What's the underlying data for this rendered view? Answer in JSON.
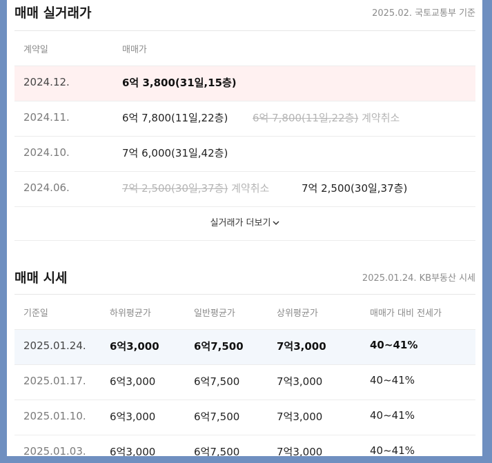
{
  "sale_trades": {
    "title": "매매 실거래가",
    "source_note": "2025.02. 국토교통부 기준",
    "columns": {
      "date": "계약일",
      "price": "매매가"
    },
    "rows": [
      {
        "date": "2024.12.",
        "price": "6억 3,800(31일,15층)"
      },
      {
        "date": "2024.11.",
        "price": "6억 7,800(11일,22층)",
        "cancelled_price": "6억 7,800(11일,22층)",
        "cancel_label": "계약취소"
      },
      {
        "date": "2024.10.",
        "price": "7억 6,000(31일,42층)"
      },
      {
        "date": "2024.06.",
        "cancelled_price": "7억 2,500(30일,37층)",
        "cancel_label": "계약취소",
        "price": "7억 2,500(30일,37층)"
      }
    ],
    "more_label": "실거래가 더보기",
    "more_icon": "chevron-down-icon"
  },
  "market_price": {
    "title": "매매 시세",
    "source_note": "2025.01.24. KB부동산 시세",
    "columns": {
      "date": "기준일",
      "low": "하위평균가",
      "mid": "일반평균가",
      "high": "상위평균가",
      "ratio": "매매가 대비 전세가"
    },
    "rows": [
      {
        "date": "2025.01.24.",
        "low": "6억3,000",
        "mid": "6억7,500",
        "high": "7억3,000",
        "ratio": "40~41%"
      },
      {
        "date": "2025.01.17.",
        "low": "6억3,000",
        "mid": "6억7,500",
        "high": "7억3,000",
        "ratio": "40~41%"
      },
      {
        "date": "2025.01.10.",
        "low": "6억3,000",
        "mid": "6억7,500",
        "high": "7억3,000",
        "ratio": "40~41%"
      },
      {
        "date": "2025.01.03.",
        "low": "6억3,000",
        "mid": "6억7,500",
        "high": "7억3,000",
        "ratio": "40~41%"
      }
    ]
  }
}
